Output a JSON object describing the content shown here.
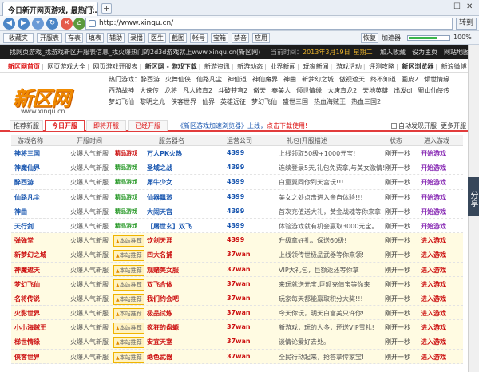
{
  "browser": {
    "tab_title": "今日新开网页游戏, 最热门…",
    "url": "http://www.xinqu.cn/",
    "go_label": "转到",
    "toolbar": [
      "收藏夹",
      "开服表",
      "存表",
      "填表",
      "辅助",
      "录播",
      "医生",
      "截图",
      "帐号",
      "宝箱",
      "禁音",
      "应用"
    ],
    "restore_label": "恢复",
    "accel_label": "加速器",
    "accel_percent": "100%",
    "accel_level": 0.7
  },
  "top_strip": {
    "message": "找网页游戏_找游戏新区开服表信息_找火爆热门的2d3d游戏就上www.xinqu.cn(新区网)",
    "time_label": "当前时间：",
    "date": "2013年3月19日",
    "weekday": "星期二",
    "links": [
      "加入收藏",
      "设为主页",
      "网站地图"
    ]
  },
  "main_nav": [
    "新区网首页",
    "网页游戏大全",
    "网页游戏开服表",
    "新区网 - 游戏下载",
    "新游资讯",
    "新游动态",
    "业界新闻",
    "玩家新闻",
    "游戏活动",
    "评测攻略",
    "新区浏览器",
    "新浪微博"
  ],
  "logo": {
    "text": "新区网",
    "url": "www.xinqu.cn"
  },
  "hot_games": {
    "label": "热门游戏：",
    "rows": [
      [
        "醉西游",
        "火舞仙侠",
        "仙路凡尘",
        "神仙道",
        "神仙魔界",
        "神曲",
        "新梦幻之城",
        "傲视遮天",
        "终不知道",
        "画皮2",
        "倾世情缘"
      ],
      [
        "西游战神",
        "大侠传",
        "龙将",
        "凡人修真2",
        "斗破苍穹2",
        "傲天",
        "秦美人",
        "倾世情缘",
        "大唐真龙2",
        "天地英雄",
        "出发ol",
        "蜀山仙侠传"
      ],
      [
        "梦幻飞仙",
        "黎明之光",
        "侠客世界",
        "仙界",
        "英雄远征",
        "梦幻飞仙",
        "盛世三国",
        "热血海贼王",
        "热血三国2"
      ]
    ]
  },
  "section_tabs": [
    "推荐新服",
    "今日开服",
    "即将开服",
    "已经开服"
  ],
  "notice": {
    "text": "《新区游戏加速浏览器》上线，",
    "link": "点击下载使用!"
  },
  "auto_refresh": "自动发现开服",
  "more_label": "更多开服",
  "table_headers": [
    "游戏名称",
    "开服时间",
    "服务器名",
    "运营公司",
    "礼包|开服描述",
    "状态",
    "进入游戏"
  ],
  "rows": [
    {
      "name": "神将三国",
      "time": "火爆人气新服",
      "badge": "精品游戏",
      "server": "万人PK火热",
      "company": "4399",
      "gift": "上线领取50级+1000元宝!",
      "status": "刚开一秒",
      "enter": "开始游戏",
      "style": "white"
    },
    {
      "name": "神魔仙界",
      "time": "火爆人气新服",
      "badge": "精品游戏",
      "server": "圣域之战",
      "company": "4399",
      "gift": "连续登录5天,礼包免费拿,与美女激情!",
      "status": "刚开一秒",
      "enter": "开始游戏",
      "style": "white"
    },
    {
      "name": "醉西游",
      "time": "火爆人气新服",
      "badge": "精品游戏",
      "server": "犀牛少女",
      "company": "4399",
      "gift": "白童冀同你到天宫玩!!!",
      "status": "刚开一秒",
      "enter": "开始游戏",
      "style": "white"
    },
    {
      "name": "仙路凡尘",
      "time": "火爆人气新服",
      "badge": "精品游戏",
      "server": "仙器飘渺",
      "company": "4399",
      "gift": "美女之处点击进入亲自体验!!!",
      "status": "刚开一秒",
      "enter": "开始游戏",
      "style": "white"
    },
    {
      "name": "神曲",
      "time": "火爆人气新服",
      "badge": "精品游戏",
      "server": "大闹天宫",
      "company": "4399",
      "gift": "首次充值送大礼，黄金战魂等你来拿!",
      "status": "刚开一秒",
      "enter": "开始游戏",
      "style": "white"
    },
    {
      "name": "天行剑",
      "time": "火爆人气新服",
      "badge": "精品游戏",
      "server": "【屠世玄】双飞",
      "company": "4399",
      "gift": "体验游戏就有机会赢取3000元宝。",
      "status": "刚开一秒",
      "enter": "开始游戏",
      "style": "white"
    },
    {
      "name": "弹弹堂",
      "time": "火爆人气新服",
      "badge": "本站推荐",
      "server": "饮剑天涯",
      "company": "4399",
      "gift": "升级拿好礼，保送60级!",
      "status": "刚开一秒",
      "enter": "进入游戏",
      "style": "yellow"
    },
    {
      "name": "新梦幻之城",
      "time": "火爆人气新服",
      "badge": "本站推荐",
      "server": "四大名捕",
      "company": "37wan",
      "gift": "上线领传世极品武器等你来领!",
      "status": "刚开一秒",
      "enter": "进入游戏",
      "style": "yellow"
    },
    {
      "name": "神魔遮天",
      "time": "火爆人气新服",
      "badge": "本站推荐",
      "server": "观赌美女服",
      "company": "37wan",
      "gift": "VIP大礼包，巨额返还等你拿",
      "status": "刚开一秒",
      "enter": "进入游戏",
      "style": "yellow"
    },
    {
      "name": "梦幻飞仙",
      "time": "火爆人气新服",
      "badge": "本站推荐",
      "server": "双飞合体",
      "company": "37wan",
      "gift": "来玩就送元宝,巨额充值宝等你来",
      "status": "刚开一秒",
      "enter": "进入游戏",
      "style": "yellow"
    },
    {
      "name": "名将传说",
      "time": "火爆人气新服",
      "badge": "本站推荐",
      "server": "我们约会吧",
      "company": "37wan",
      "gift": "玩家每天都能赢取积分大奖!!!",
      "status": "刚开一秒",
      "enter": "进入游戏",
      "style": "yellow"
    },
    {
      "name": "火影世界",
      "time": "火爆人气新服",
      "badge": "本站推荐",
      "server": "极品试炼",
      "company": "37wan",
      "gift": "今天你玩，明天白富美只许你!",
      "status": "刚开一秒",
      "enter": "进入游戏",
      "style": "yellow"
    },
    {
      "name": "小小海贼王",
      "time": "火爆人气新服",
      "badge": "本站推荐",
      "server": "疯狂的盘螈",
      "company": "37wan",
      "gift": "新游戏，玩的人多，还送VIP雪礼!",
      "status": "刚开一秒",
      "enter": "进入游戏",
      "style": "yellow"
    },
    {
      "name": "梯世情缘",
      "time": "火爆人气新服",
      "badge": "本站推荐",
      "server": "安宜天室",
      "company": "37wan",
      "gift": "谈情论爱好去处。",
      "status": "刚开一秒",
      "enter": "进入游戏",
      "style": "yellow"
    },
    {
      "name": "侠客世界",
      "time": "火爆人气新服",
      "badge": "本站推荐",
      "server": "绝色武器",
      "company": "37wan",
      "gift": "全民行动起来，抢答拿传家宝!",
      "status": "刚开一秒",
      "enter": "进入游戏",
      "style": "yellow"
    }
  ]
}
